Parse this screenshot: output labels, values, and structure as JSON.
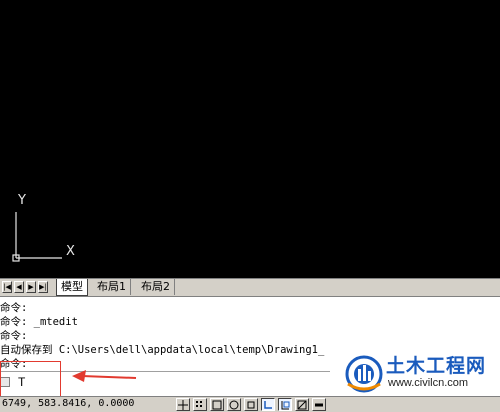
{
  "canvas": {
    "ucs_x_label": "X",
    "ucs_y_label": "Y",
    "background": "#000000"
  },
  "tabs": {
    "model": "模型",
    "layout1": "布局1",
    "layout2": "布局2"
  },
  "command_history": [
    "命令:",
    "命令: _mtedit",
    "命令:",
    "自动保存到 C:\\Users\\dell\\appdata\\local\\temp\\Drawing1_",
    "命令:"
  ],
  "command_input": {
    "value": "T"
  },
  "annotation": {
    "color": "#e23a2f"
  },
  "watermark": {
    "brand": "土木工程网",
    "url": "www.civilcn.com",
    "color": "#1a5bbd"
  },
  "status": {
    "coordinates": "6749, 583.8416, 0.0000",
    "buttons": [
      "snap-icon",
      "grid-icon",
      "ortho-icon",
      "polar-icon",
      "osnap-icon",
      "otrack-icon",
      "ducs-icon",
      "dyn-icon",
      "lwt-icon",
      "qp-icon"
    ]
  }
}
